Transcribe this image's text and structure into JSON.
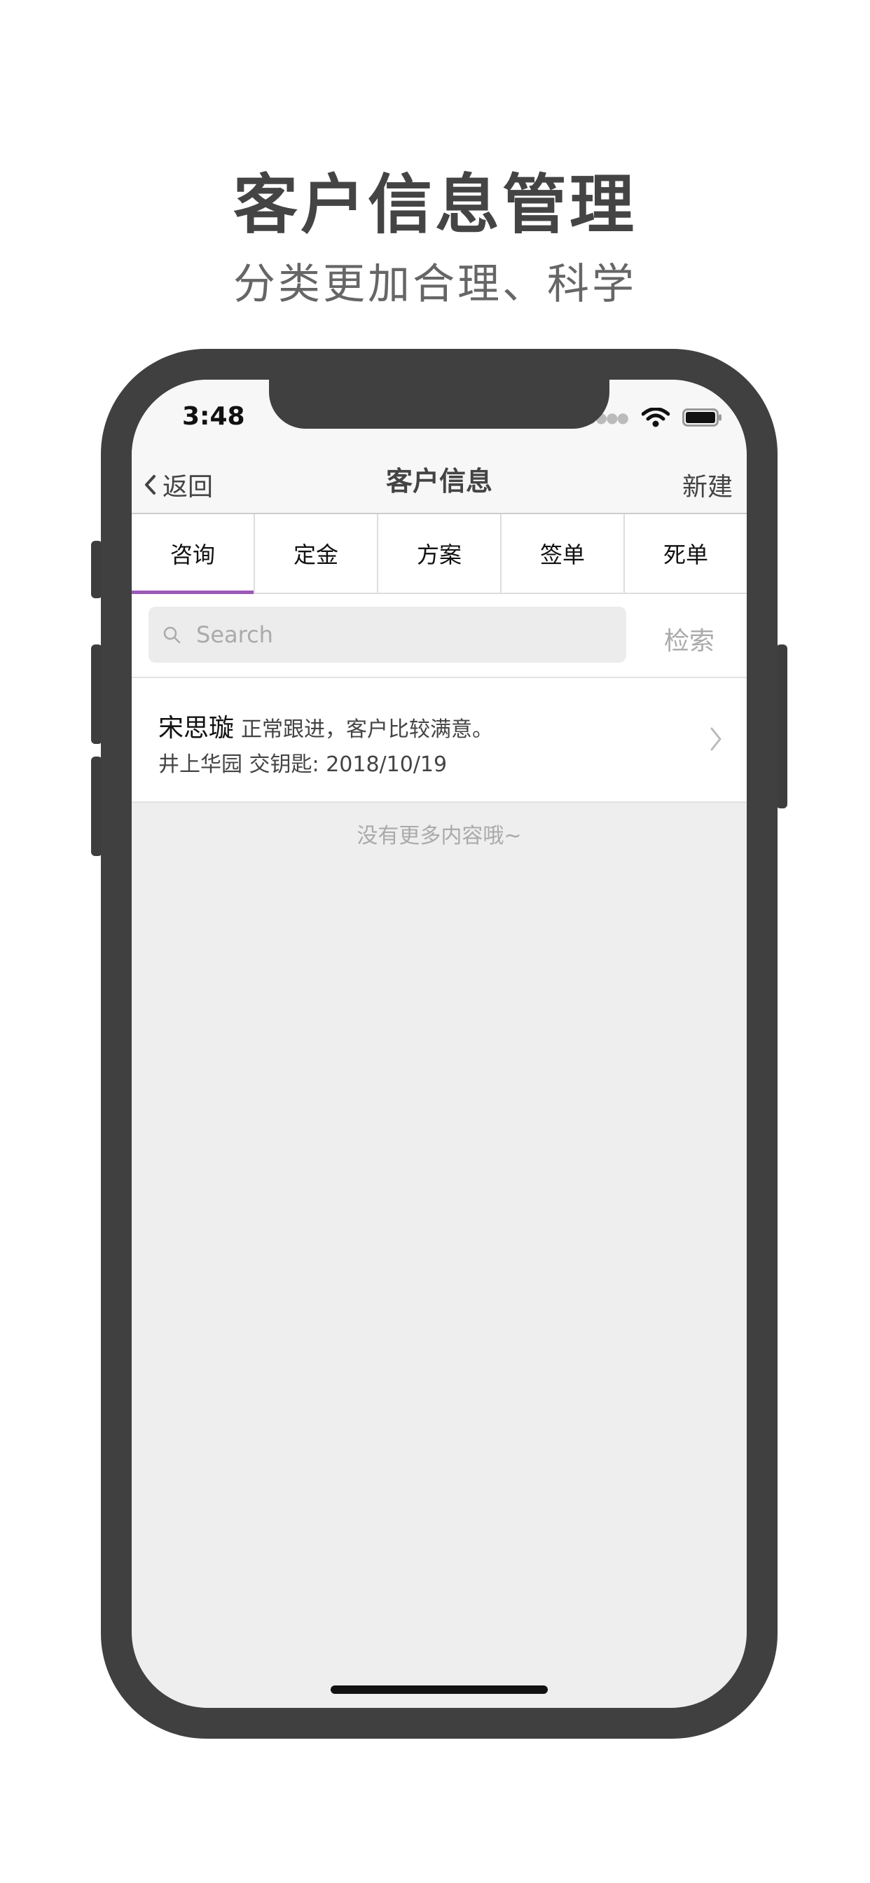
{
  "promo": {
    "title": "客户信息管理",
    "subtitle": "分类更加合理、科学"
  },
  "status_bar": {
    "time": "3:48",
    "icons": [
      "signal-dots-icon",
      "wifi-icon",
      "battery-icon"
    ]
  },
  "nav": {
    "back_label": "返回",
    "title": "客户信息",
    "new_label": "新建"
  },
  "tabs": [
    {
      "label": "咨询",
      "active": true
    },
    {
      "label": "定金",
      "active": false
    },
    {
      "label": "方案",
      "active": false
    },
    {
      "label": "签单",
      "active": false
    },
    {
      "label": "死单",
      "active": false
    }
  ],
  "search": {
    "placeholder": "Search",
    "value": "",
    "button_label": "检索"
  },
  "customers": [
    {
      "name": "宋思璇",
      "note": "正常跟进，客户比较满意。",
      "community": "井上华园",
      "key_label": "交钥匙: 2018/10/19"
    }
  ],
  "list_footer": "没有更多内容哦~",
  "colors": {
    "accent": "#9b59b6",
    "frame": "#404040",
    "background": "#eeeeee"
  }
}
